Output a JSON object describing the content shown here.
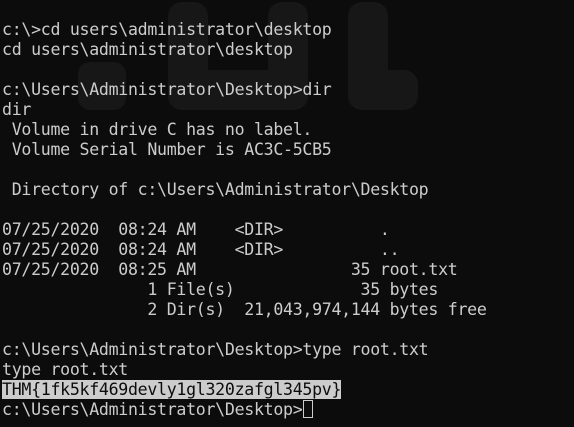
{
  "terminal": {
    "lines": [
      "c:\\>cd users\\administrator\\desktop",
      "cd users\\administrator\\desktop",
      "",
      "c:\\Users\\Administrator\\Desktop>dir",
      "dir",
      " Volume in drive C has no label.",
      " Volume Serial Number is AC3C-5CB5",
      "",
      " Directory of c:\\Users\\Administrator\\Desktop",
      "",
      "07/25/2020  08:24 AM    <DIR>          .",
      "07/25/2020  08:24 AM    <DIR>          ..",
      "07/25/2020  08:25 AM                35 root.txt",
      "               1 File(s)             35 bytes",
      "               2 Dir(s)  21,043,974,144 bytes free",
      "",
      "c:\\Users\\Administrator\\Desktop>type root.txt",
      "type root.txt"
    ],
    "flag_text": "THM{1fk5kf469devly1gl320zafgl345pv}",
    "prompt": "c:\\Users\\Administrator\\Desktop>"
  }
}
